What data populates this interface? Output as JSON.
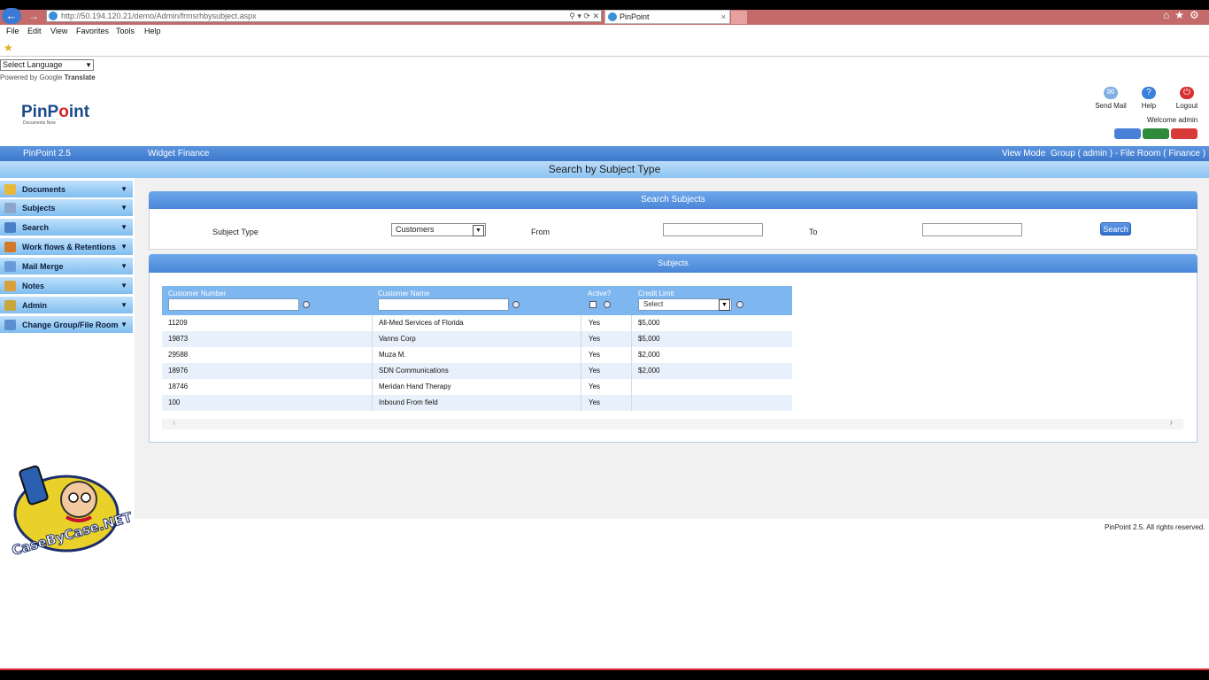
{
  "browser": {
    "address": "http://50.194.120.21/demo/Admin/frmsrhbysubject.aspx",
    "tab_title": "PinPoint",
    "tab_close": "×",
    "back_glyph": "←",
    "forward_glyph": "→",
    "address_tools": "⚲ ▾ ⟳ ✕",
    "right_icons": "⌂★⚙",
    "menu": [
      "File",
      "Edit",
      "View",
      "Favorites",
      "Tools",
      "Help"
    ]
  },
  "translate": {
    "select_label": "Select Language",
    "powered_prefix": "Powered by",
    "powered_brand": "Google",
    "powered_suffix": "Translate"
  },
  "logo": {
    "text_a": "PinP",
    "text_b": "o",
    "text_c": "int",
    "tagline": "Documents Now"
  },
  "top_actions": {
    "send_mail": "Send Mail",
    "help": "Help",
    "logout": "Logout",
    "welcome": "Welcome admin"
  },
  "app_bar": {
    "version": "PinPoint 2.5",
    "company": "Widget Finance",
    "view_mode": "View Mode",
    "context": "Group ( admin ) - File Room ( Finance )"
  },
  "page_title": "Search by Subject Type",
  "sidebar": {
    "items": [
      {
        "label": "Documents",
        "color": "#e8b83a"
      },
      {
        "label": "Subjects",
        "color": "#8aa6c8"
      },
      {
        "label": "Search",
        "color": "#4a7fc8"
      },
      {
        "label": "Work flows & Retentions",
        "color": "#d07a2a"
      },
      {
        "label": "Mail Merge",
        "color": "#6a9bd8"
      },
      {
        "label": "Notes",
        "color": "#d9a040"
      },
      {
        "label": "Admin",
        "color": "#c9a640"
      },
      {
        "label": "Change Group/File Room",
        "color": "#5c8fd0"
      }
    ]
  },
  "search": {
    "header": "Search Subjects",
    "subject_type_label": "Subject Type",
    "subject_type_value": "Customers",
    "from_label": "From",
    "from_value": "",
    "to_label": "To",
    "to_value": "",
    "button": "Search"
  },
  "subjects": {
    "header": "Subjects",
    "columns": [
      "Customer Number",
      "Customer Name",
      "Active?",
      "Credit Limit"
    ],
    "credit_filter": "Select",
    "rows": [
      [
        "11209",
        "All-Med Services of Florida",
        "Yes",
        "$5,000"
      ],
      [
        "19873",
        "Vanns Corp",
        "Yes",
        "$5,000"
      ],
      [
        "29588",
        "Muza M.",
        "Yes",
        "$2,000"
      ],
      [
        "18976",
        "SDN Communications",
        "Yes",
        "$2,000"
      ],
      [
        "18746",
        "Meridan Hand Therapy",
        "Yes",
        ""
      ],
      [
        "100",
        "Inbound From field",
        "Yes",
        ""
      ]
    ]
  },
  "cbc": {
    "text": "CaseByCase.NET"
  },
  "footer": "PinPoint 2.5.  All rights reserved."
}
